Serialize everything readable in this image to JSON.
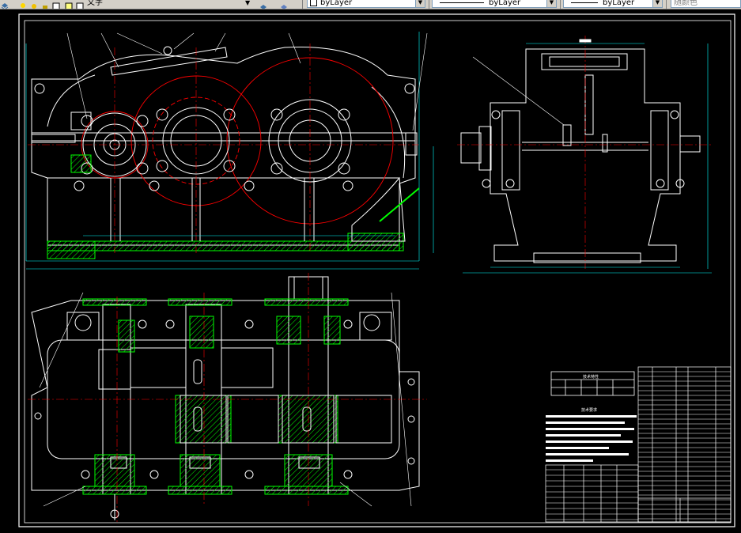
{
  "toolbar": {
    "text_style_label": "文字",
    "layer_combo": "byLayer",
    "linetype_combo": "byLayer",
    "lineweight_combo": "byLayer",
    "color_combo": "随颜色"
  },
  "colors": {
    "background": "#000000",
    "outline": "#ffffff",
    "gear_circles": "#ff0000",
    "dimensions": "#00ffff",
    "hatch": "#00ff00",
    "toolbar": "#d4d0c8"
  },
  "drawing": {
    "table_tech_spec_title": "技术特性",
    "table_tech_req_title": "技术要求"
  }
}
